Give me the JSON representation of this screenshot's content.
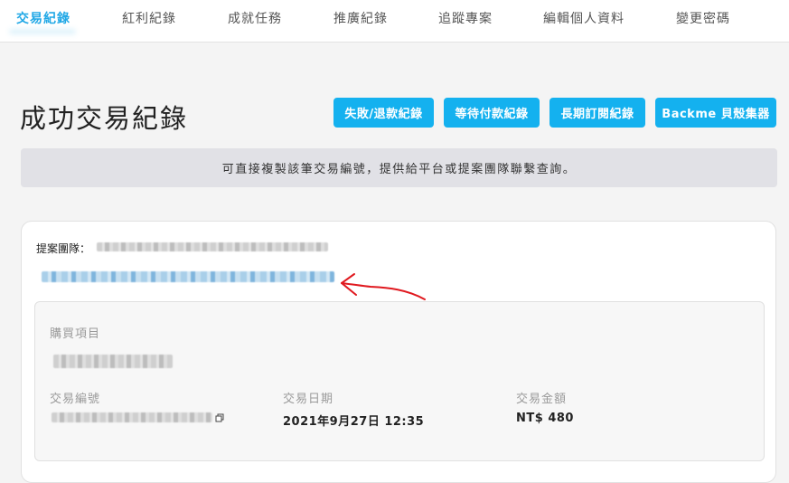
{
  "nav": {
    "items": [
      {
        "label": "交易紀錄",
        "active": true
      },
      {
        "label": "紅利紀錄",
        "active": false
      },
      {
        "label": "成就任務",
        "active": false
      },
      {
        "label": "推廣紀錄",
        "active": false
      },
      {
        "label": "追蹤專案",
        "active": false
      },
      {
        "label": "編輯個人資料",
        "active": false
      },
      {
        "label": "變更密碼",
        "active": false
      }
    ]
  },
  "page": {
    "title": "成功交易紀錄"
  },
  "actions": {
    "failed_refund": "失敗/退款紀錄",
    "pending_payment": "等待付款紀錄",
    "subscription": "長期訂閱紀錄",
    "backme_collector": "Backme 貝殼集器"
  },
  "notice": {
    "text": "可直接複製該筆交易編號，提供給平台或提案團隊聯繫查詢。"
  },
  "record": {
    "team_label": "提案團隊：",
    "item_label": "購買項目",
    "txn_id_label": "交易編號",
    "date_label": "交易日期",
    "date_value": "2021年9月27日 12:35",
    "amount_label": "交易金額",
    "amount_value": "NT$ 480"
  },
  "colors": {
    "accent": "#14b1ef",
    "annotation": "#e0191f"
  }
}
